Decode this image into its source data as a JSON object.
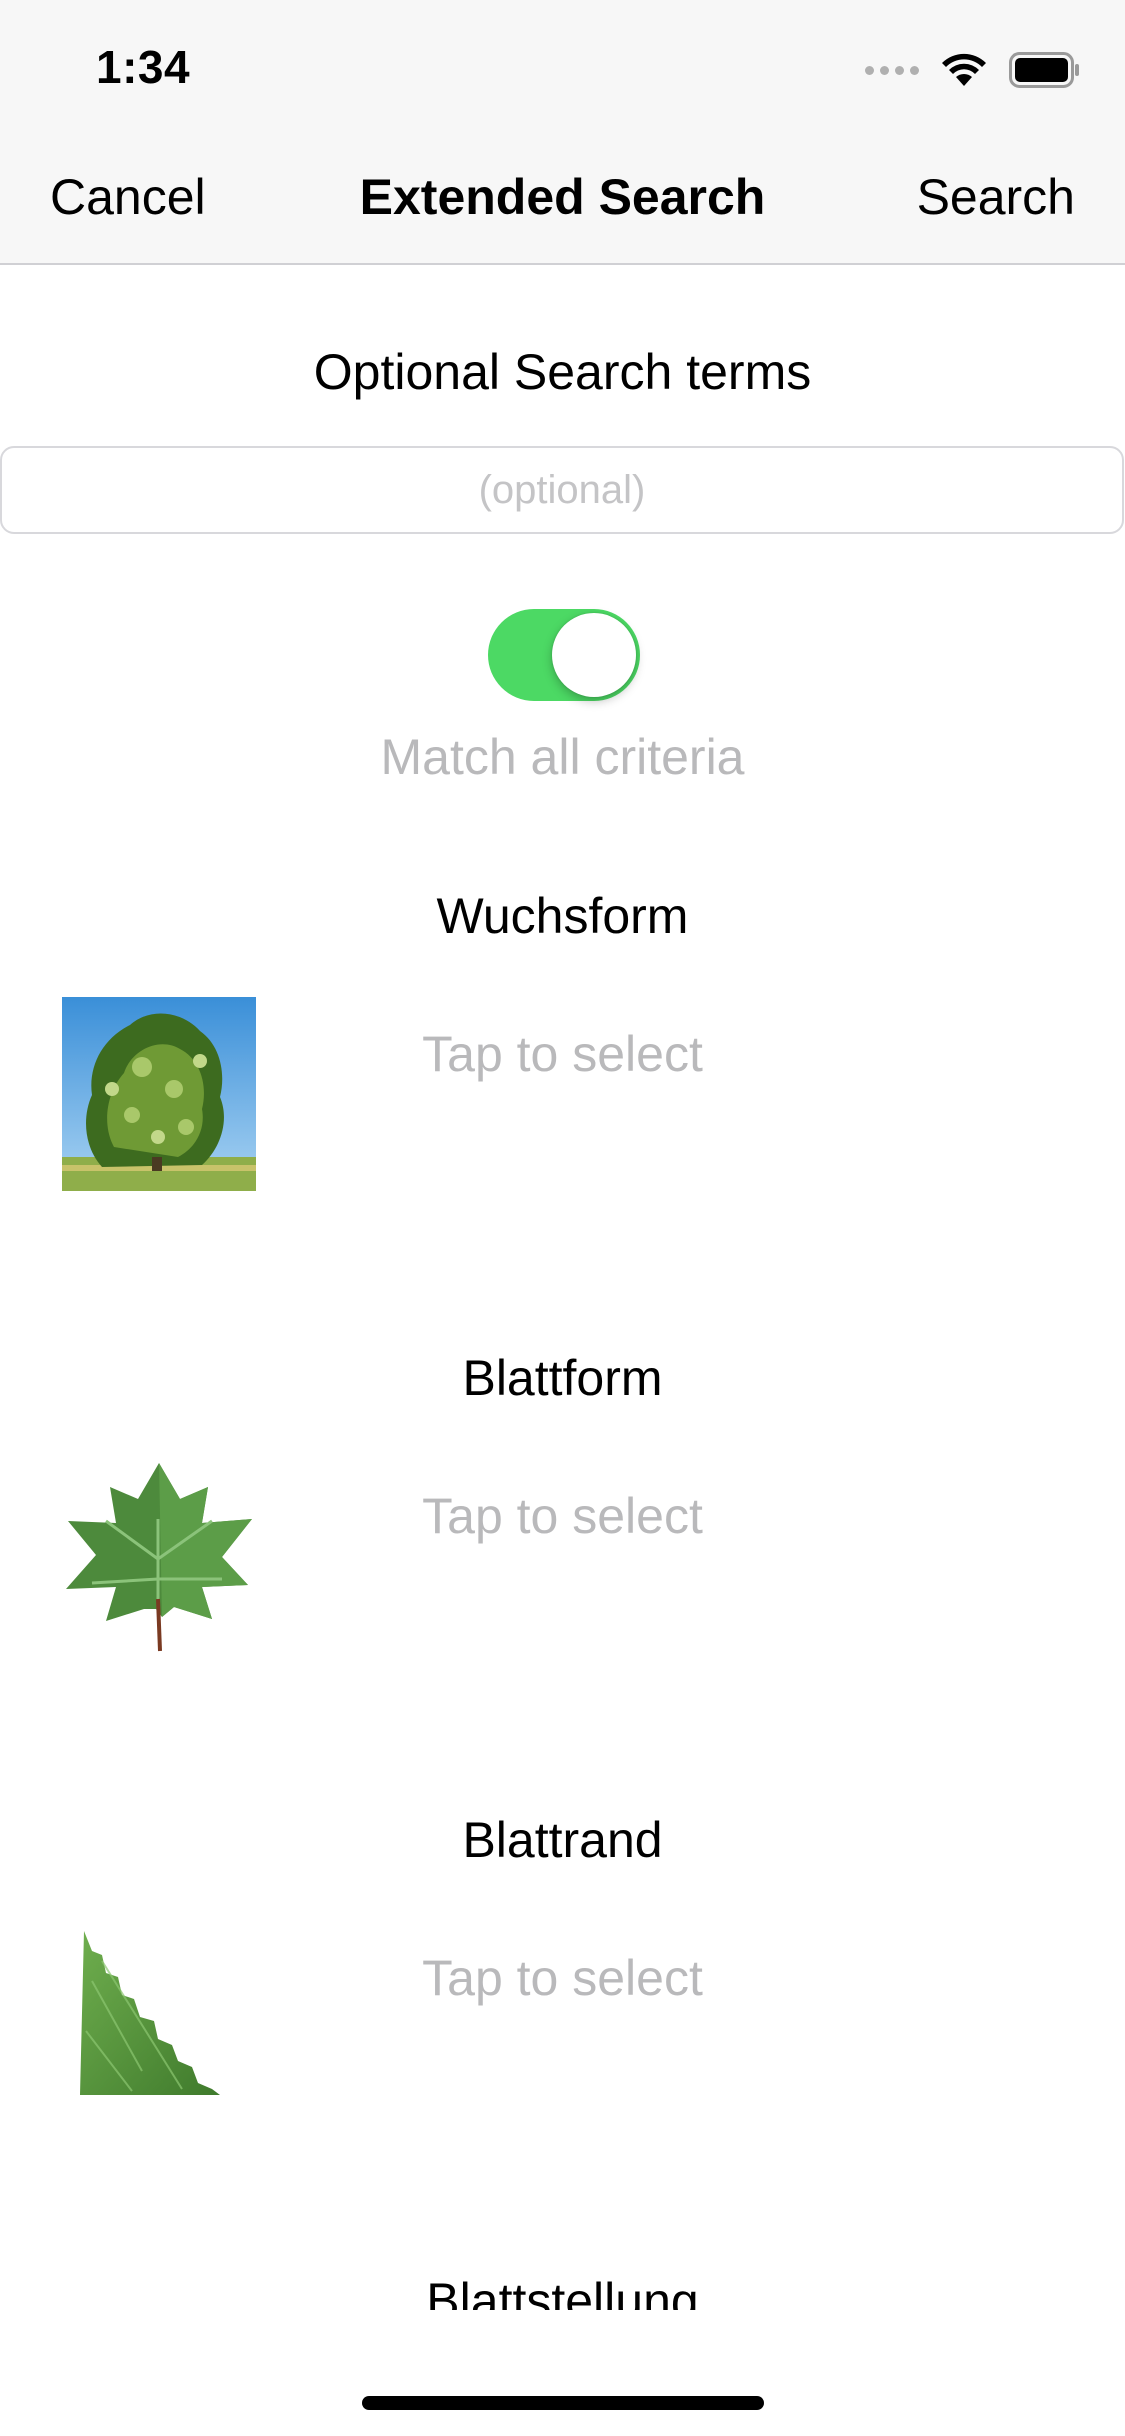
{
  "status_bar": {
    "time": "1:34"
  },
  "nav": {
    "cancel_label": "Cancel",
    "title": "Extended Search",
    "search_label": "Search"
  },
  "search_terms": {
    "heading": "Optional Search terms",
    "placeholder": "(optional)",
    "value": ""
  },
  "match_all": {
    "label": "Match all criteria",
    "enabled": true,
    "on_color": "#4cd964"
  },
  "criteria": [
    {
      "heading": "Wuchsform",
      "placeholder": "Tap to select",
      "image": "tree-photo"
    },
    {
      "heading": "Blattform",
      "placeholder": "Tap to select",
      "image": "maple-leaf-photo"
    },
    {
      "heading": "Blattrand",
      "placeholder": "Tap to select",
      "image": "leaf-edge-photo"
    },
    {
      "heading": "Blattstellung"
    }
  ]
}
